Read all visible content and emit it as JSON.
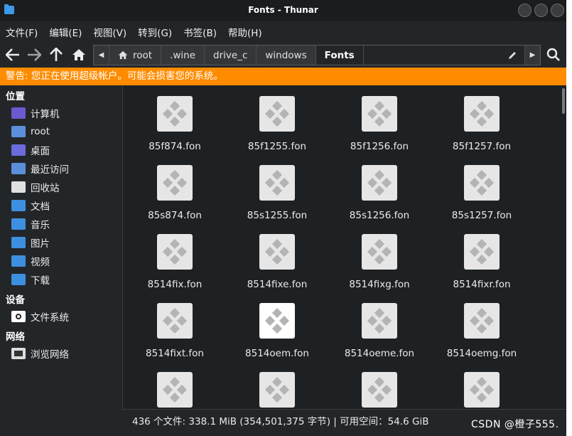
{
  "window": {
    "title": "Fonts - Thunar"
  },
  "menu": [
    "文件(F)",
    "编辑(E)",
    "视图(V)",
    "转到(G)",
    "书签(B)",
    "帮助(H)"
  ],
  "breadcrumbs": [
    {
      "label": "root",
      "icon": "home-icon"
    },
    {
      "label": ".wine"
    },
    {
      "label": "drive_c"
    },
    {
      "label": "windows"
    },
    {
      "label": "Fonts",
      "active": true
    }
  ],
  "warning": "警告: 您正在使用超级帐户。可能会损害您的系统。",
  "sidebar": {
    "places_heading": "位置",
    "places": [
      {
        "label": "计算机",
        "icon": "computer-icon",
        "color": "#6a5acd"
      },
      {
        "label": "root",
        "icon": "home-folder-icon",
        "color": "#5b8fd9"
      },
      {
        "label": "桌面",
        "icon": "desktop-folder-icon",
        "color": "#6b6bdc"
      },
      {
        "label": "最近访问",
        "icon": "recent-icon",
        "color": "#5b8fd9"
      },
      {
        "label": "回收站",
        "icon": "trash-icon",
        "color": "#e0e0e0"
      },
      {
        "label": "文档",
        "icon": "documents-folder-icon",
        "color": "#3d8fe0"
      },
      {
        "label": "音乐",
        "icon": "music-folder-icon",
        "color": "#3d8fe0"
      },
      {
        "label": "图片",
        "icon": "pictures-folder-icon",
        "color": "#3d8fe0"
      },
      {
        "label": "视频",
        "icon": "videos-folder-icon",
        "color": "#3d8fe0"
      },
      {
        "label": "下载",
        "icon": "downloads-folder-icon",
        "color": "#3d8fe0"
      }
    ],
    "devices_heading": "设备",
    "devices": [
      {
        "label": "文件系统",
        "icon": "filesystem-icon"
      }
    ],
    "network_heading": "网络",
    "network": [
      {
        "label": "浏览网络",
        "icon": "network-icon"
      }
    ]
  },
  "files": [
    {
      "name": "85f874.fon"
    },
    {
      "name": "85f1255.fon"
    },
    {
      "name": "85f1256.fon"
    },
    {
      "name": "85f1257.fon"
    },
    {
      "name": "85s874.fon"
    },
    {
      "name": "85s1255.fon"
    },
    {
      "name": "85s1256.fon"
    },
    {
      "name": "85s1257.fon"
    },
    {
      "name": "8514fix.fon"
    },
    {
      "name": "8514fixe.fon"
    },
    {
      "name": "8514fixg.fon"
    },
    {
      "name": "8514fixr.fon"
    },
    {
      "name": "8514fixt.fon"
    },
    {
      "name": "8514oem.fon",
      "selected": true
    },
    {
      "name": "8514oeme.fon"
    },
    {
      "name": "8514oemg.fon"
    },
    {
      "name": ""
    },
    {
      "name": ""
    },
    {
      "name": ""
    },
    {
      "name": ""
    }
  ],
  "status": "436 个文件: 338.1 MiB (354,501,375 字节) | 可用空间：54.6 GiB",
  "watermark": "CSDN @橙子555.",
  "colors": {
    "warning": "#ff8c00",
    "accent": "#3d9ae8",
    "background": "#232629"
  }
}
